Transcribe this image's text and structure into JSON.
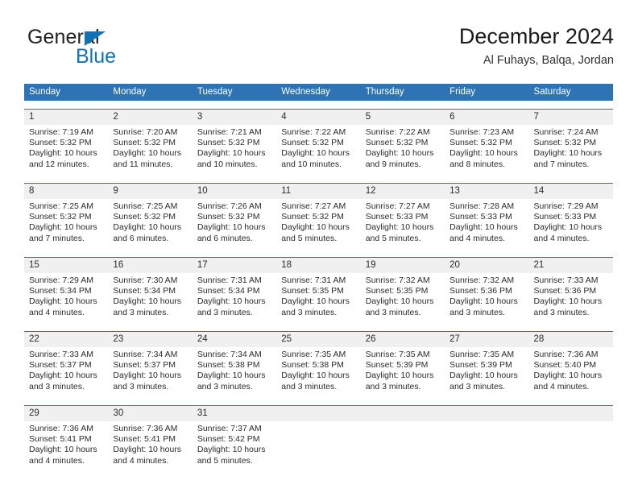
{
  "brand": {
    "name_part1": "General",
    "name_part2": "Blue",
    "accent_color": "#1272b8"
  },
  "header": {
    "title": "December 2024",
    "location": "Al Fuhays, Balqa, Jordan"
  },
  "colors": {
    "header_blue": "#2e74b5",
    "daynum_band": "#f0f0f0",
    "text": "#2b2b2b"
  },
  "weekdays": [
    "Sunday",
    "Monday",
    "Tuesday",
    "Wednesday",
    "Thursday",
    "Friday",
    "Saturday"
  ],
  "weeks": [
    [
      {
        "day": "1",
        "sunrise": "Sunrise: 7:19 AM",
        "sunset": "Sunset: 5:32 PM",
        "daylight1": "Daylight: 10 hours",
        "daylight2": "and 12 minutes."
      },
      {
        "day": "2",
        "sunrise": "Sunrise: 7:20 AM",
        "sunset": "Sunset: 5:32 PM",
        "daylight1": "Daylight: 10 hours",
        "daylight2": "and 11 minutes."
      },
      {
        "day": "3",
        "sunrise": "Sunrise: 7:21 AM",
        "sunset": "Sunset: 5:32 PM",
        "daylight1": "Daylight: 10 hours",
        "daylight2": "and 10 minutes."
      },
      {
        "day": "4",
        "sunrise": "Sunrise: 7:22 AM",
        "sunset": "Sunset: 5:32 PM",
        "daylight1": "Daylight: 10 hours",
        "daylight2": "and 10 minutes."
      },
      {
        "day": "5",
        "sunrise": "Sunrise: 7:22 AM",
        "sunset": "Sunset: 5:32 PM",
        "daylight1": "Daylight: 10 hours",
        "daylight2": "and 9 minutes."
      },
      {
        "day": "6",
        "sunrise": "Sunrise: 7:23 AM",
        "sunset": "Sunset: 5:32 PM",
        "daylight1": "Daylight: 10 hours",
        "daylight2": "and 8 minutes."
      },
      {
        "day": "7",
        "sunrise": "Sunrise: 7:24 AM",
        "sunset": "Sunset: 5:32 PM",
        "daylight1": "Daylight: 10 hours",
        "daylight2": "and 7 minutes."
      }
    ],
    [
      {
        "day": "8",
        "sunrise": "Sunrise: 7:25 AM",
        "sunset": "Sunset: 5:32 PM",
        "daylight1": "Daylight: 10 hours",
        "daylight2": "and 7 minutes."
      },
      {
        "day": "9",
        "sunrise": "Sunrise: 7:25 AM",
        "sunset": "Sunset: 5:32 PM",
        "daylight1": "Daylight: 10 hours",
        "daylight2": "and 6 minutes."
      },
      {
        "day": "10",
        "sunrise": "Sunrise: 7:26 AM",
        "sunset": "Sunset: 5:32 PM",
        "daylight1": "Daylight: 10 hours",
        "daylight2": "and 6 minutes."
      },
      {
        "day": "11",
        "sunrise": "Sunrise: 7:27 AM",
        "sunset": "Sunset: 5:32 PM",
        "daylight1": "Daylight: 10 hours",
        "daylight2": "and 5 minutes."
      },
      {
        "day": "12",
        "sunrise": "Sunrise: 7:27 AM",
        "sunset": "Sunset: 5:33 PM",
        "daylight1": "Daylight: 10 hours",
        "daylight2": "and 5 minutes."
      },
      {
        "day": "13",
        "sunrise": "Sunrise: 7:28 AM",
        "sunset": "Sunset: 5:33 PM",
        "daylight1": "Daylight: 10 hours",
        "daylight2": "and 4 minutes."
      },
      {
        "day": "14",
        "sunrise": "Sunrise: 7:29 AM",
        "sunset": "Sunset: 5:33 PM",
        "daylight1": "Daylight: 10 hours",
        "daylight2": "and 4 minutes."
      }
    ],
    [
      {
        "day": "15",
        "sunrise": "Sunrise: 7:29 AM",
        "sunset": "Sunset: 5:34 PM",
        "daylight1": "Daylight: 10 hours",
        "daylight2": "and 4 minutes."
      },
      {
        "day": "16",
        "sunrise": "Sunrise: 7:30 AM",
        "sunset": "Sunset: 5:34 PM",
        "daylight1": "Daylight: 10 hours",
        "daylight2": "and 3 minutes."
      },
      {
        "day": "17",
        "sunrise": "Sunrise: 7:31 AM",
        "sunset": "Sunset: 5:34 PM",
        "daylight1": "Daylight: 10 hours",
        "daylight2": "and 3 minutes."
      },
      {
        "day": "18",
        "sunrise": "Sunrise: 7:31 AM",
        "sunset": "Sunset: 5:35 PM",
        "daylight1": "Daylight: 10 hours",
        "daylight2": "and 3 minutes."
      },
      {
        "day": "19",
        "sunrise": "Sunrise: 7:32 AM",
        "sunset": "Sunset: 5:35 PM",
        "daylight1": "Daylight: 10 hours",
        "daylight2": "and 3 minutes."
      },
      {
        "day": "20",
        "sunrise": "Sunrise: 7:32 AM",
        "sunset": "Sunset: 5:36 PM",
        "daylight1": "Daylight: 10 hours",
        "daylight2": "and 3 minutes."
      },
      {
        "day": "21",
        "sunrise": "Sunrise: 7:33 AM",
        "sunset": "Sunset: 5:36 PM",
        "daylight1": "Daylight: 10 hours",
        "daylight2": "and 3 minutes."
      }
    ],
    [
      {
        "day": "22",
        "sunrise": "Sunrise: 7:33 AM",
        "sunset": "Sunset: 5:37 PM",
        "daylight1": "Daylight: 10 hours",
        "daylight2": "and 3 minutes."
      },
      {
        "day": "23",
        "sunrise": "Sunrise: 7:34 AM",
        "sunset": "Sunset: 5:37 PM",
        "daylight1": "Daylight: 10 hours",
        "daylight2": "and 3 minutes."
      },
      {
        "day": "24",
        "sunrise": "Sunrise: 7:34 AM",
        "sunset": "Sunset: 5:38 PM",
        "daylight1": "Daylight: 10 hours",
        "daylight2": "and 3 minutes."
      },
      {
        "day": "25",
        "sunrise": "Sunrise: 7:35 AM",
        "sunset": "Sunset: 5:38 PM",
        "daylight1": "Daylight: 10 hours",
        "daylight2": "and 3 minutes."
      },
      {
        "day": "26",
        "sunrise": "Sunrise: 7:35 AM",
        "sunset": "Sunset: 5:39 PM",
        "daylight1": "Daylight: 10 hours",
        "daylight2": "and 3 minutes."
      },
      {
        "day": "27",
        "sunrise": "Sunrise: 7:35 AM",
        "sunset": "Sunset: 5:39 PM",
        "daylight1": "Daylight: 10 hours",
        "daylight2": "and 3 minutes."
      },
      {
        "day": "28",
        "sunrise": "Sunrise: 7:36 AM",
        "sunset": "Sunset: 5:40 PM",
        "daylight1": "Daylight: 10 hours",
        "daylight2": "and 4 minutes."
      }
    ],
    [
      {
        "day": "29",
        "sunrise": "Sunrise: 7:36 AM",
        "sunset": "Sunset: 5:41 PM",
        "daylight1": "Daylight: 10 hours",
        "daylight2": "and 4 minutes."
      },
      {
        "day": "30",
        "sunrise": "Sunrise: 7:36 AM",
        "sunset": "Sunset: 5:41 PM",
        "daylight1": "Daylight: 10 hours",
        "daylight2": "and 4 minutes."
      },
      {
        "day": "31",
        "sunrise": "Sunrise: 7:37 AM",
        "sunset": "Sunset: 5:42 PM",
        "daylight1": "Daylight: 10 hours",
        "daylight2": "and 5 minutes."
      },
      {
        "day": "",
        "sunrise": "",
        "sunset": "",
        "daylight1": "",
        "daylight2": ""
      },
      {
        "day": "",
        "sunrise": "",
        "sunset": "",
        "daylight1": "",
        "daylight2": ""
      },
      {
        "day": "",
        "sunrise": "",
        "sunset": "",
        "daylight1": "",
        "daylight2": ""
      },
      {
        "day": "",
        "sunrise": "",
        "sunset": "",
        "daylight1": "",
        "daylight2": ""
      }
    ]
  ]
}
